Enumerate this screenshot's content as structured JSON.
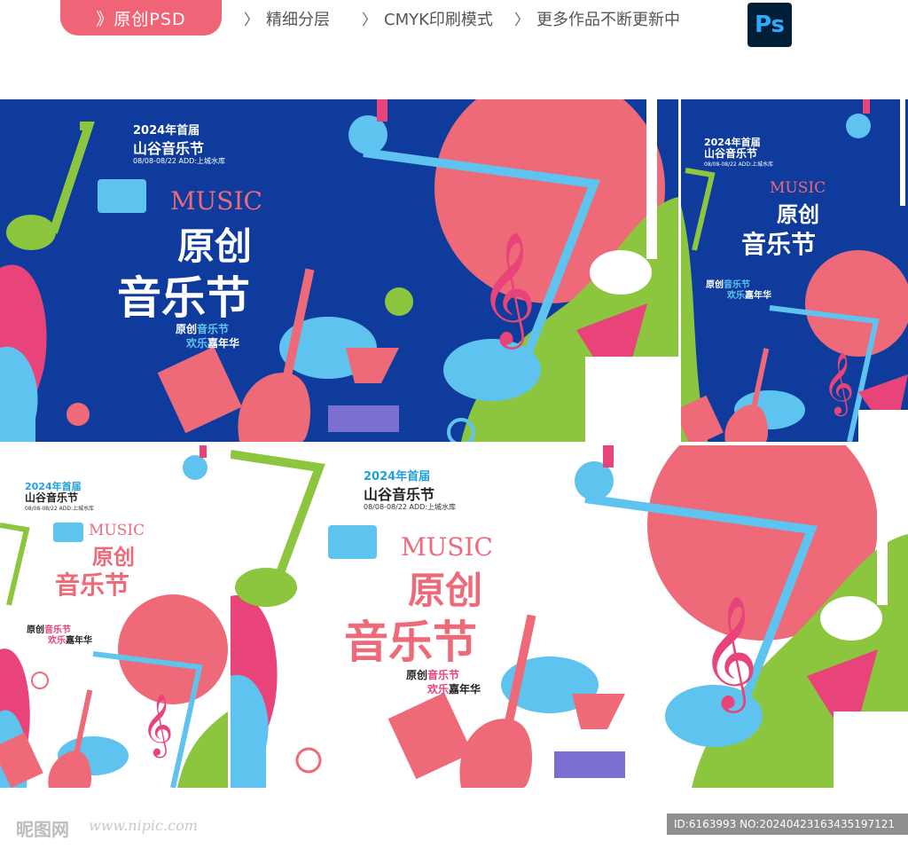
{
  "header": {
    "badge_label": "》原创PSD",
    "features": [
      "精细分层",
      "CMYK印刷模式",
      "更多作品不断更新中"
    ],
    "ps_label": "Ps"
  },
  "poster": {
    "year_line": "2024年首届",
    "festival_name": "山谷音乐节",
    "date_addr": "08/08-08/22  ADD:上城水库",
    "music_word": "MUSIC",
    "title_1": "原创",
    "title_2": "音乐节",
    "slogan_1a": "原创",
    "slogan_1b": "音乐节",
    "slogan_2a": "欢乐",
    "slogan_2b": "嘉年华"
  },
  "footer": {
    "watermark": "昵图网",
    "watermark_url": "www.nipic.com",
    "id_line": "ID:6163993 NO:20240423163435197121"
  },
  "colors": {
    "blue_bg": "#0f3c9c",
    "pink": "#ee6a78",
    "coral": "#f06478",
    "green": "#8cc63f",
    "sky": "#5ec3ef",
    "magenta": "#e8447a",
    "purple": "#7a6fd0"
  }
}
